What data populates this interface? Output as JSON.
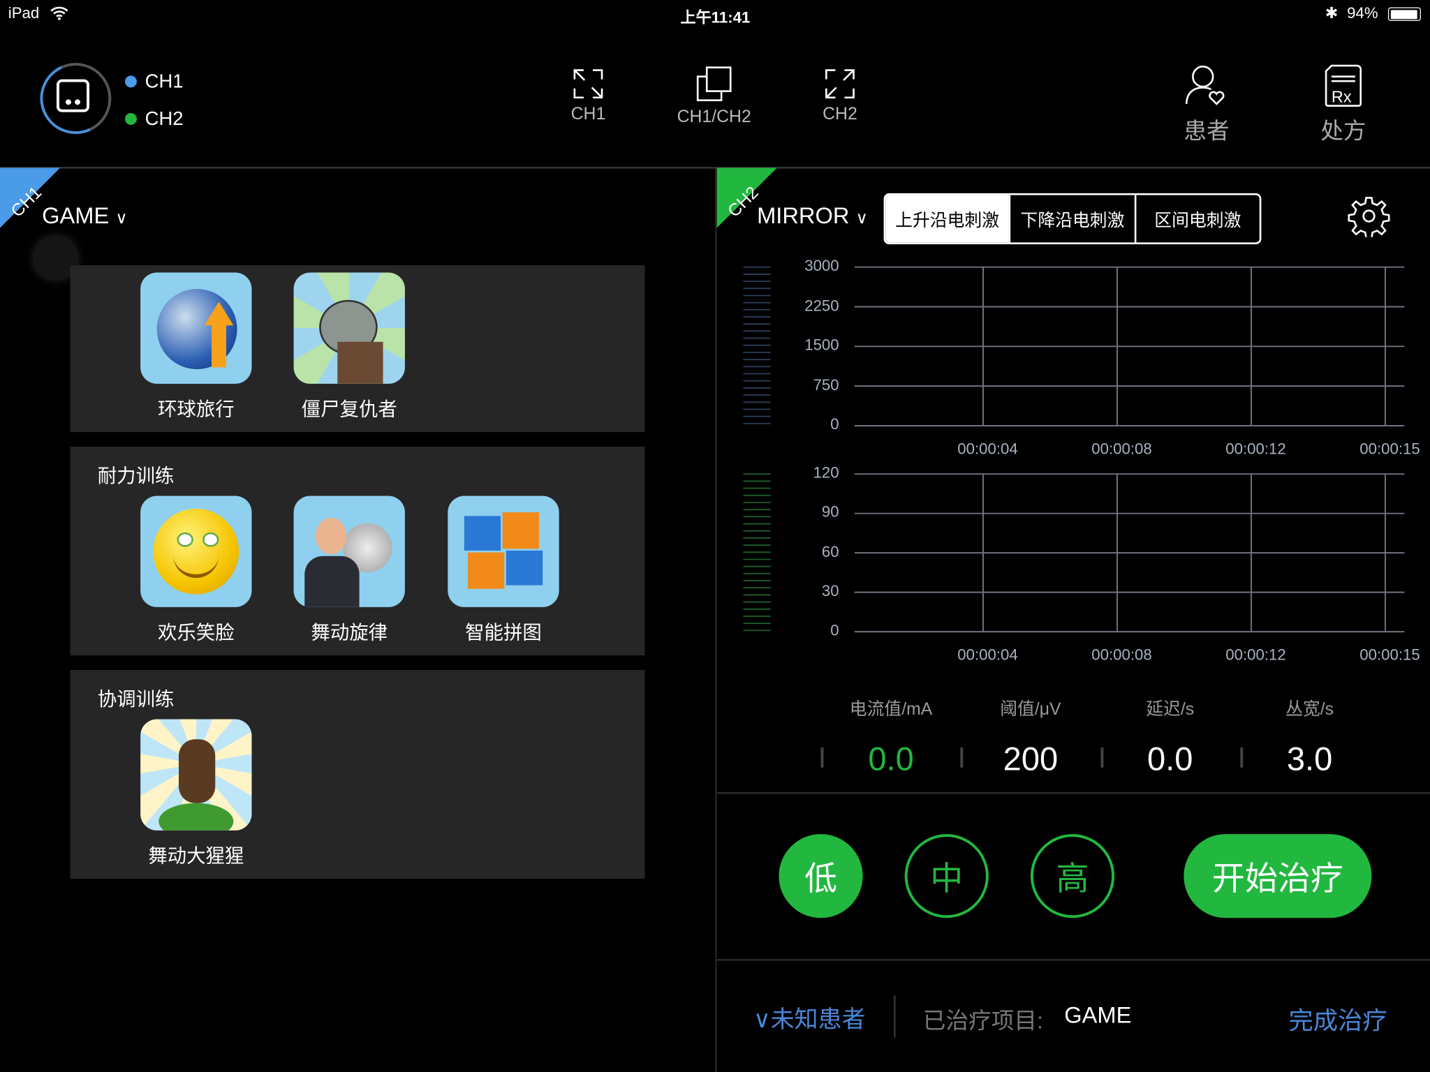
{
  "status_bar": {
    "device": "iPad",
    "time": "上午11:41",
    "battery": "94%",
    "battery_level": 0.94
  },
  "header": {
    "channels": [
      {
        "label": "CH1",
        "color": "#4a9be8"
      },
      {
        "label": "CH2",
        "color": "#22b83f"
      }
    ],
    "view_modes": [
      {
        "label": "CH1",
        "icon": "expand-icon"
      },
      {
        "label": "CH1/CH2",
        "icon": "dual-window-icon"
      },
      {
        "label": "CH2",
        "icon": "expand-icon"
      }
    ],
    "patient_label": "患者",
    "prescription_label": "处方"
  },
  "ch1": {
    "badge": "CH1",
    "mode": "GAME",
    "sections": [
      {
        "title": "",
        "games": [
          {
            "name": "环球旅行",
            "icon": "globe-arrow-icon"
          },
          {
            "name": "僵尸复仇者",
            "icon": "zombie-icon"
          }
        ]
      },
      {
        "title": "耐力训练",
        "games": [
          {
            "name": "欢乐笑脸",
            "icon": "smiley-icon"
          },
          {
            "name": "舞动旋律",
            "icon": "music-man-icon"
          },
          {
            "name": "智能拼图",
            "icon": "puzzle-icon"
          }
        ]
      },
      {
        "title": "协调训练",
        "games": [
          {
            "name": "舞动大猩猩",
            "icon": "gorilla-icon"
          }
        ]
      }
    ]
  },
  "ch2": {
    "badge": "CH2",
    "mode": "MIRROR",
    "stim_tabs": [
      "上升沿电刺激",
      "下降沿电刺激",
      "区间电刺激"
    ],
    "active_tab": 0,
    "params": [
      {
        "label": "电流值/mA",
        "value": "0.0"
      },
      {
        "label": "阈值/μV",
        "value": "200"
      },
      {
        "label": "延迟/s",
        "value": "0.0"
      },
      {
        "label": "丛宽/s",
        "value": "3.0"
      }
    ],
    "levels": [
      "低",
      "中",
      "高"
    ],
    "active_level": 0,
    "start_label": "开始治疗"
  },
  "footer": {
    "patient": "未知患者",
    "treated_label": "已治疗项目:",
    "treated_value": "GAME",
    "finish_label": "完成治疗"
  },
  "colors": {
    "green": "#22b83f",
    "blue": "#4a9be8",
    "link": "#4a86d8"
  },
  "chart_data": [
    {
      "type": "line",
      "series": [],
      "yticks": [
        "3000",
        "2250",
        "1500",
        "750",
        "0"
      ],
      "ylim": [
        0,
        3000
      ],
      "xticks": [
        "00:00:04",
        "00:00:08",
        "00:00:12",
        "00:00:15"
      ],
      "grid": true
    },
    {
      "type": "line",
      "series": [],
      "yticks": [
        "120",
        "90",
        "60",
        "30",
        "0"
      ],
      "ylim": [
        0,
        120
      ],
      "xticks": [
        "00:00:04",
        "00:00:08",
        "00:00:12",
        "00:00:15"
      ],
      "grid": true
    }
  ]
}
